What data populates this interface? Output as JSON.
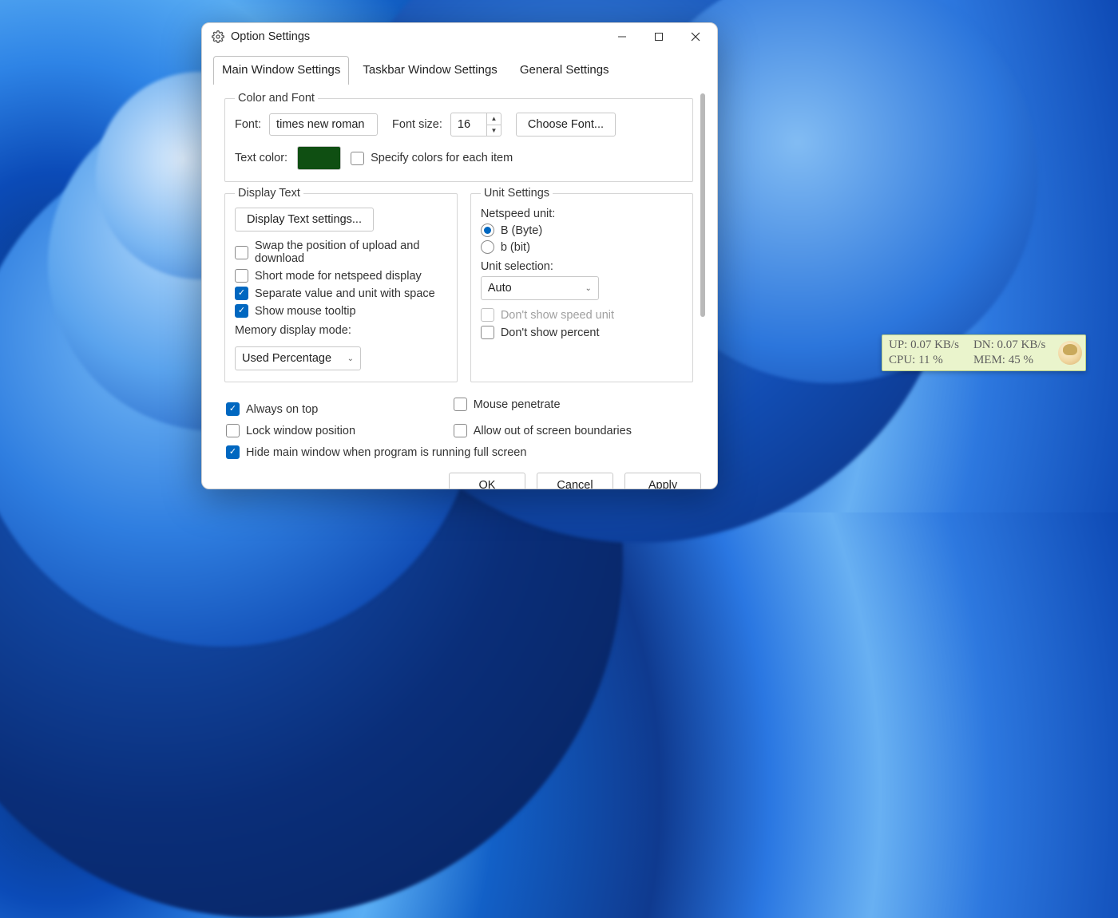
{
  "window": {
    "title": "Option Settings",
    "tabs": [
      "Main Window Settings",
      "Taskbar Window Settings",
      "General Settings"
    ],
    "active_tab": 0
  },
  "color_and_font": {
    "legend": "Color and Font",
    "font_label": "Font:",
    "font_value": "times new roman",
    "font_size_label": "Font size:",
    "font_size_value": "16",
    "choose_font_button": "Choose Font...",
    "text_color_label": "Text color:",
    "text_color_value": "#0f4f12",
    "specify_colors_label": "Specify colors for each item",
    "specify_colors_checked": false
  },
  "display_text": {
    "legend": "Display Text",
    "settings_button": "Display Text settings...",
    "swap_label": "Swap the position of upload and download",
    "swap_checked": false,
    "short_mode_label": "Short mode for netspeed display",
    "short_mode_checked": false,
    "separate_label": "Separate value and unit with space",
    "separate_checked": true,
    "tooltip_label": "Show mouse tooltip",
    "tooltip_checked": true,
    "memory_mode_label": "Memory display mode:",
    "memory_mode_value": "Used Percentage"
  },
  "unit_settings": {
    "legend": "Unit Settings",
    "netspeed_unit_label": "Netspeed unit:",
    "radio_byte_label": "B (Byte)",
    "radio_bit_label": "b (bit)",
    "radio_selected": "byte",
    "unit_selection_label": "Unit selection:",
    "unit_selection_value": "Auto",
    "dont_show_speed_unit_label": "Don't show speed unit",
    "dont_show_speed_unit_checked": false,
    "dont_show_speed_unit_disabled": true,
    "dont_show_percent_label": "Don't show percent",
    "dont_show_percent_checked": false
  },
  "general_checks": {
    "always_on_top_label": "Always on top",
    "always_on_top_checked": true,
    "mouse_penetrate_label": "Mouse penetrate",
    "mouse_penetrate_checked": false,
    "lock_position_label": "Lock window position",
    "lock_position_checked": false,
    "allow_out_label": "Allow out of screen boundaries",
    "allow_out_checked": false,
    "hide_fullscreen_label": "Hide main window when program is running full screen",
    "hide_fullscreen_checked": true
  },
  "dialog_buttons": {
    "ok": "OK",
    "cancel": "Cancel",
    "apply": "Apply"
  },
  "widget": {
    "up": "UP: 0.07 KB/s",
    "dn": "DN: 0.07 KB/s",
    "cpu": "CPU: 11 %",
    "mem": "MEM: 45 %"
  }
}
